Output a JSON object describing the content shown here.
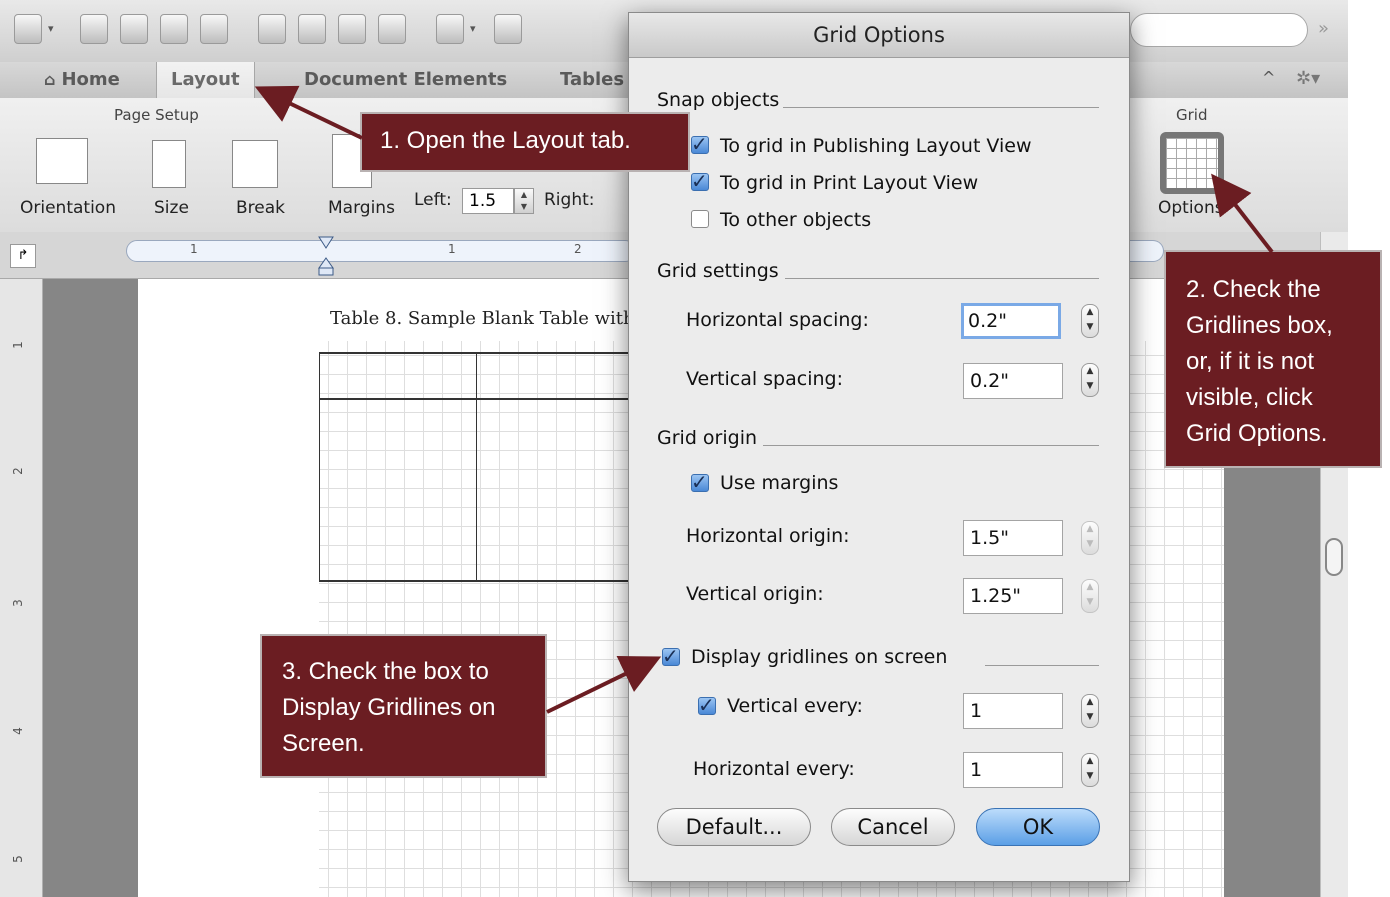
{
  "ribbon_tabs": {
    "home": "Home",
    "layout": "Layout",
    "document_elements": "Document Elements",
    "tables": "Tables"
  },
  "ribbon": {
    "page_setup_label": "Page Setup",
    "orientation": "Orientation",
    "size": "Size",
    "break": "Break",
    "margins": "Margins",
    "left_label": "Left:",
    "left_value": "1.5",
    "right_label": "Right:",
    "grid_group_label": "Grid",
    "options": "Options"
  },
  "ruler": {
    "h_marks": [
      "1",
      "1",
      "2"
    ],
    "v_marks": [
      "1",
      "2",
      "3",
      "4",
      "5"
    ]
  },
  "document": {
    "table_caption": "Table 8. Sample Blank Table with"
  },
  "dialog": {
    "title": "Grid Options",
    "snap_objects": {
      "heading": "Snap objects",
      "to_grid_publishing": "To grid in Publishing Layout View",
      "to_grid_print": "To grid in Print Layout View",
      "to_other_objects": "To other objects",
      "to_grid_publishing_checked": true,
      "to_grid_print_checked": true,
      "to_other_objects_checked": false
    },
    "grid_settings": {
      "heading": "Grid settings",
      "horizontal_spacing_label": "Horizontal spacing:",
      "horizontal_spacing_value": "0.2\"",
      "vertical_spacing_label": "Vertical spacing:",
      "vertical_spacing_value": "0.2\""
    },
    "grid_origin": {
      "heading": "Grid origin",
      "use_margins": "Use margins",
      "use_margins_checked": true,
      "horizontal_origin_label": "Horizontal origin:",
      "horizontal_origin_value": "1.5\"",
      "vertical_origin_label": "Vertical origin:",
      "vertical_origin_value": "1.25\""
    },
    "display": {
      "display_gridlines": "Display gridlines on screen",
      "display_gridlines_checked": true,
      "vertical_every_label": "Vertical every:",
      "vertical_every_checked": true,
      "vertical_every_value": "1",
      "horizontal_every_label": "Horizontal every:",
      "horizontal_every_value": "1"
    },
    "buttons": {
      "default": "Default...",
      "cancel": "Cancel",
      "ok": "OK"
    }
  },
  "annotations": {
    "step1": "1. Open the Layout tab.",
    "step2": "2. Check the Gridlines box, or, if it is not visible, click Grid Options.",
    "step3": "3. Check the box to Display Gridlines on Screen.",
    "color": "#6b1d22"
  },
  "colors": {
    "accent_blue": "#5b9fe6",
    "callout_bg": "#6b1d22"
  }
}
